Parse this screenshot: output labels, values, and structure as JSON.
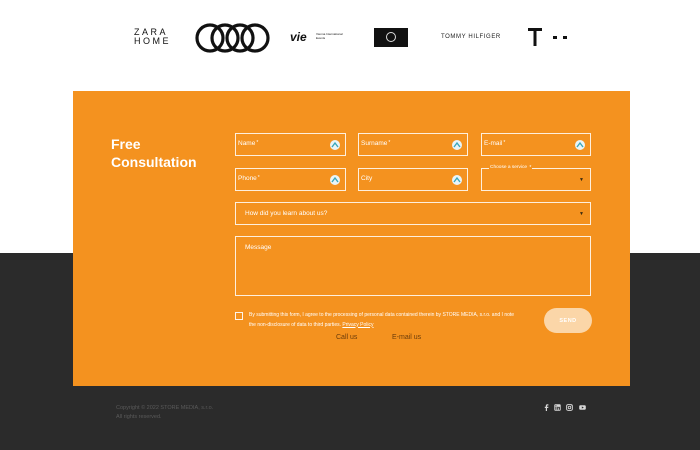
{
  "logos": {
    "zara_home": [
      "ZARA",
      "HOME"
    ],
    "audi": "audi-rings-logo",
    "vie": "vie",
    "vie_sub": "Vienna International Events",
    "body_shop": "the-body-shop-logo",
    "tommy": "TOMMY HILFIGER",
    "telekom": "T · ·"
  },
  "form": {
    "title": "Free Consultation",
    "name_label": "Name",
    "surname_label": "Surname",
    "email_label": "E-mail",
    "phone_label": "Phone",
    "city_label": "City",
    "required_mark": "*",
    "service_legend": "Choose a service",
    "howdid_placeholder": "How did you learn about us?",
    "message_placeholder": "Message",
    "consent_text": "By submitting this form, I agree to the processing of personal data contained therein by STORE MEDIA, s.r.o. and I note the non-disclosure of data to third parties.",
    "privacy_link": "Privacy Policy",
    "send_label": "SEND",
    "call_label": "Call us",
    "email_link_label": "E-mail us"
  },
  "footer": {
    "copyright_line1": "Copyright © 2022 STORE MEDIA, s.r.o.",
    "copyright_line2": "All rights reserved.",
    "socials": [
      "facebook-icon",
      "linkedin-icon",
      "instagram-icon",
      "youtube-icon"
    ]
  },
  "colors": {
    "panel": "#f4921f",
    "dark": "#2b2b2b",
    "send_button": "#fbd6a8"
  }
}
